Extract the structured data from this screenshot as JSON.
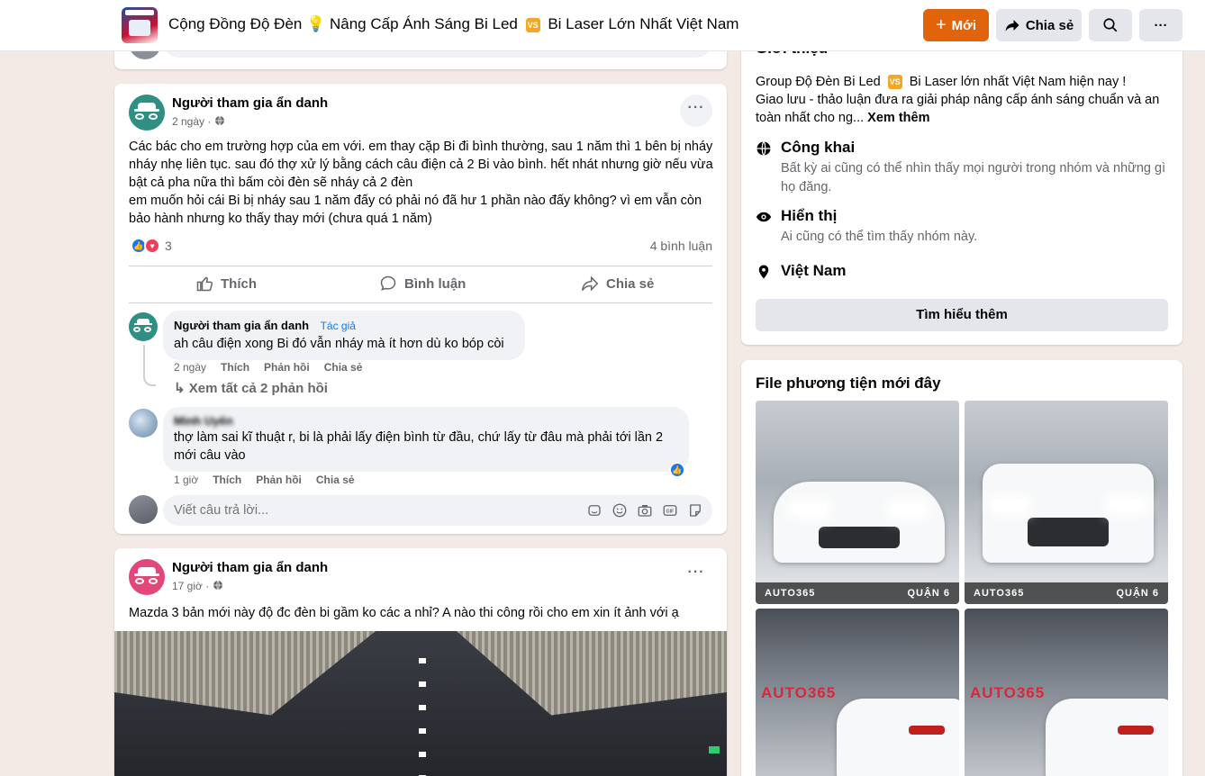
{
  "header": {
    "title_part1": "Cộng Đồng Độ Đèn 💡 Nâng Cấp Ánh Sáng Bi Led",
    "vs_badge": "VS",
    "title_part2": "Bi Laser Lớn Nhất Việt Nam",
    "new_button": "Mới",
    "share_button": "Chia sẻ",
    "more_button": "···"
  },
  "post1": {
    "author": "Người tham gia ẩn danh",
    "time": "2 ngày",
    "text": "Các bác cho em trường hợp của em với. em thay cặp Bi đi bình thường, sau 1 năm thì 1 bên bị nháy nháy nhẹ liên tục. sau đó thợ xử lý bằng cách câu điện cả 2 Bi vào bình. hết nhát nhưng giờ nếu vừa bật cả pha nữa thì bấm còi đèn sẽ nháy cả 2 đèn\nem muốn hỏi cái Bi bị nháy sau 1 năm đấy có phải nó đã hư 1 phần nào đấy không? vì em vẫn còn bảo hành nhưng ko thấy thay mới (chưa quá 1 năm)",
    "reaction_count": "3",
    "comment_count": "4 bình luận",
    "actions": {
      "like": "Thích",
      "comment": "Bình luận",
      "share": "Chia sẻ"
    },
    "comments": [
      {
        "name": "Người tham gia ẩn danh",
        "tag": "Tác giả",
        "text": "ah câu điện xong Bi đó vẫn nháy mà ít hơn dù ko bóp còi",
        "time": "2 ngày",
        "like": "Thích",
        "reply": "Phản hồi",
        "share": "Chia sẻ"
      },
      {
        "name": "Minh Uyên",
        "text": "thợ làm sai kĩ thuật r, bi là phải lấy điện bình từ đầu, chứ lấy từ đâu mà phải tới lần 2 mới câu vào",
        "time": "1 giờ",
        "like": "Thích",
        "reply": "Phản hồi",
        "share": "Chia sẻ"
      }
    ],
    "see_replies": "↳ Xem tất cả 2 phản hồi",
    "reply_placeholder": "Viết câu trả lời..."
  },
  "post2": {
    "author": "Người tham gia ẩn danh",
    "time": "17 giờ",
    "text": "Mazda 3 bản mới này độ đc đèn bi gầm ko các a nhỉ? A nào thi công rồi cho em xin ít ảnh với ạ"
  },
  "about": {
    "heading": "Giới thiệu",
    "desc_part1": "Group Độ Đèn Bi Led",
    "desc_badge": "VS",
    "desc_part2": "Bi Laser lớn nhất Việt Nam hiện nay !\nGiao lưu - thảo luận đưa ra giải pháp nâng cấp ánh sáng chuẩn và an toàn nhất cho ng...",
    "see_more": "Xem thêm",
    "public_title": "Công khai",
    "public_desc": "Bất kỳ ai cũng có thể nhìn thấy mọi người trong nhóm và những gì họ đăng.",
    "visible_title": "Hiển thị",
    "visible_desc": "Ai cũng có thể tìm thấy nhóm này.",
    "location": "Việt Nam",
    "learn_more": "Tìm hiểu thêm"
  },
  "media": {
    "heading": "File phương tiện mới đây",
    "thumb_brand": "AUTO365",
    "thumb_branch": "QUẬN 6"
  },
  "colors": {
    "accent_orange": "#e1640d",
    "fb_blue": "#1877f2",
    "page_bg": "#f3e9e5"
  }
}
